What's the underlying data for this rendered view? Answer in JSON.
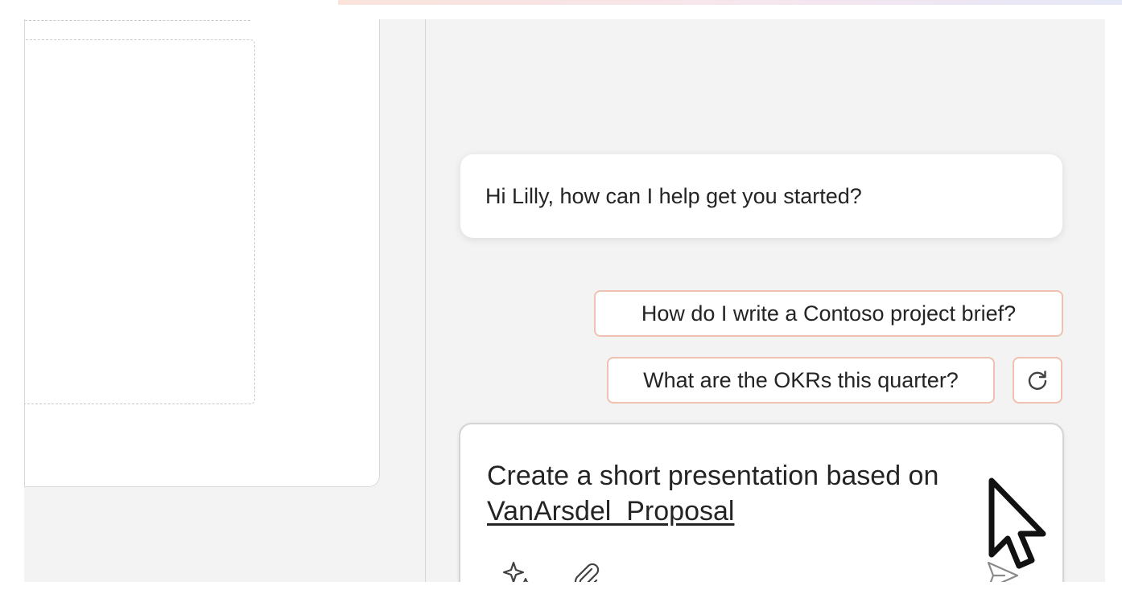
{
  "chat": {
    "greeting": "Hi Lilly, how can I help get you started?",
    "suggestions": [
      "How do I write a Contoso project brief?",
      "What are the OKRs this quarter?"
    ]
  },
  "compose": {
    "prompt_text": "Create a short presentation based on",
    "file_reference": "VanArsdel_Proposal"
  },
  "icons": {
    "refresh": "refresh-icon",
    "prompt_guide": "sparkle-icon",
    "attach": "paperclip-icon",
    "send": "send-icon",
    "cursor": "mouse-cursor-icon"
  },
  "colors": {
    "suggestion_border": "#f0c0b0",
    "pane_background": "#f3f3f3",
    "text": "#242424"
  }
}
